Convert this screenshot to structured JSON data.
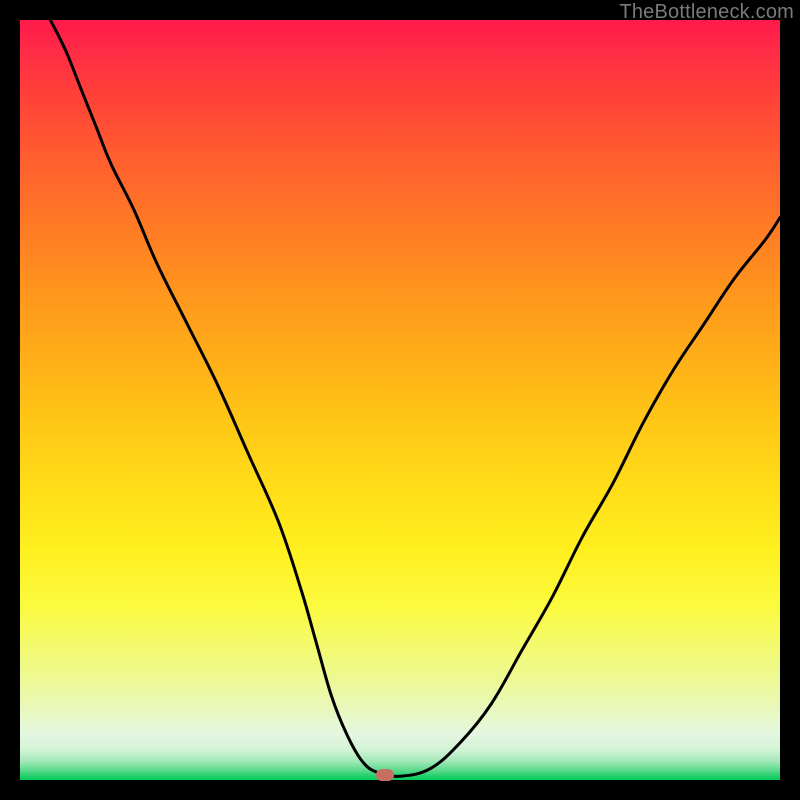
{
  "watermark": "TheBottleneck.com",
  "chart_data": {
    "type": "line",
    "title": "",
    "xlabel": "",
    "ylabel": "",
    "xlim": [
      0,
      100
    ],
    "ylim": [
      0,
      100
    ],
    "series": [
      {
        "name": "bottleneck-curve",
        "x": [
          4,
          6,
          8,
          10,
          12,
          15,
          18,
          22,
          26,
          30,
          34,
          37,
          39,
          41,
          43,
          45,
          47,
          50,
          54,
          58,
          62,
          66,
          70,
          74,
          78,
          82,
          86,
          90,
          94,
          98,
          100
        ],
        "y": [
          100,
          96,
          91,
          86,
          81,
          75,
          68,
          60,
          52,
          43,
          34,
          25,
          18,
          11,
          6,
          2.5,
          1,
          0.5,
          1.5,
          5,
          10,
          17,
          24,
          32,
          39,
          47,
          54,
          60,
          66,
          71,
          74
        ]
      }
    ],
    "marker": {
      "x": 48,
      "y": 0.6
    },
    "gradient_stops": [
      {
        "pos": 0,
        "color": "#ff1a4c"
      },
      {
        "pos": 50,
        "color": "#ffc000"
      },
      {
        "pos": 80,
        "color": "#fbfa3e"
      },
      {
        "pos": 100,
        "color": "#07cc5c"
      }
    ]
  }
}
